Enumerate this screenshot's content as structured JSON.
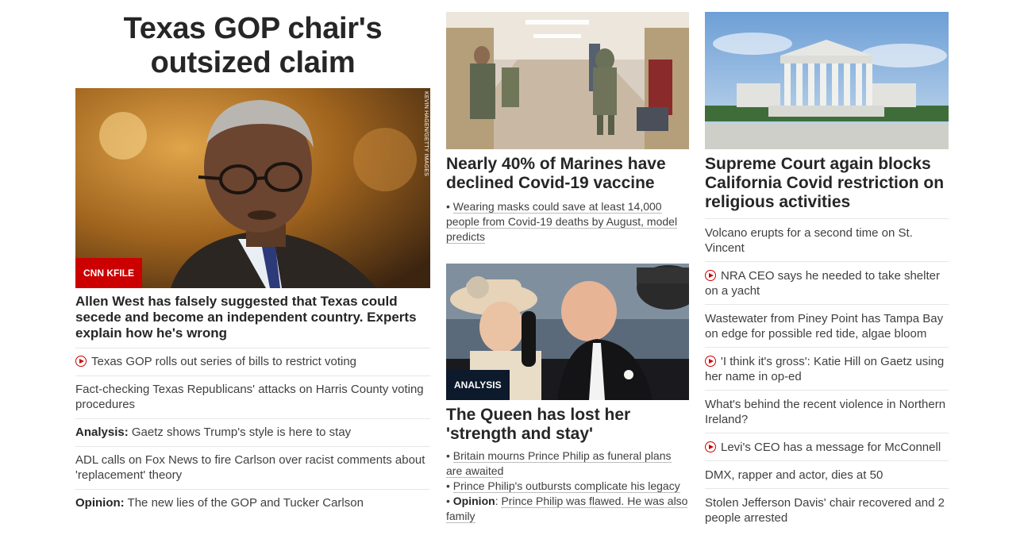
{
  "col1": {
    "headline": "Texas GOP chair's outsized claim",
    "photo": {
      "credit": "KEVIN HAGEN/GETTY IMAGES",
      "kicker": "CNN KFILE"
    },
    "story_title": "Allen West has falsely suggested that Texas could secede and become an independent country. Experts explain how he's wrong",
    "items": [
      {
        "text": "Texas GOP rolls out series of bills to restrict voting",
        "video": true
      },
      {
        "text": "Fact-checking Texas Republicans' attacks on Harris County voting procedures"
      },
      {
        "prefix": "Analysis:",
        "text": " Gaetz shows Trump's style is here to stay"
      },
      {
        "text": "ADL calls on Fox News to fire Carlson over racist comments about 'replacement' theory"
      },
      {
        "prefix": "Opinion:",
        "text": " The new lies of the GOP and Tucker Carlson"
      }
    ]
  },
  "col2": {
    "story1": {
      "title": "Nearly 40% of Marines have declined Covid-19 vaccine",
      "bullets": [
        {
          "text": "Wearing masks could save at least 14,000 people from Covid-19 deaths by August, model predicts"
        }
      ]
    },
    "story2": {
      "kicker": "ANALYSIS",
      "title": "The Queen has lost her 'strength and stay'",
      "bullets": [
        {
          "text": "Britain mourns Prince Philip as funeral plans are awaited"
        },
        {
          "text": "Prince Philip's outbursts complicate his legacy"
        },
        {
          "prefix": "Opinion",
          "text": "Prince Philip was flawed. He was also family"
        }
      ]
    }
  },
  "col3": {
    "story_title": "Supreme Court again blocks California Covid restriction on religious activities",
    "items": [
      {
        "text": "Volcano erupts for a second time on St. Vincent"
      },
      {
        "text": "NRA CEO says he needed to take shelter on a yacht",
        "video": true
      },
      {
        "text": "Wastewater from Piney Point has Tampa Bay on edge for possible red tide, algae bloom"
      },
      {
        "text": "'I think it's gross': Katie Hill on Gaetz using her name in op-ed",
        "video": true
      },
      {
        "text": "What's behind the recent violence in Northern Ireland?"
      },
      {
        "text": "Levi's CEO has a message for McConnell",
        "video": true
      },
      {
        "text": "DMX, rapper and actor, dies at 50"
      },
      {
        "text": "Stolen Jefferson Davis' chair recovered and 2 people arrested"
      }
    ]
  },
  "colors": {
    "accent": "#cc0000",
    "kicker_dark": "#0c1a2b",
    "text": "#262626"
  }
}
